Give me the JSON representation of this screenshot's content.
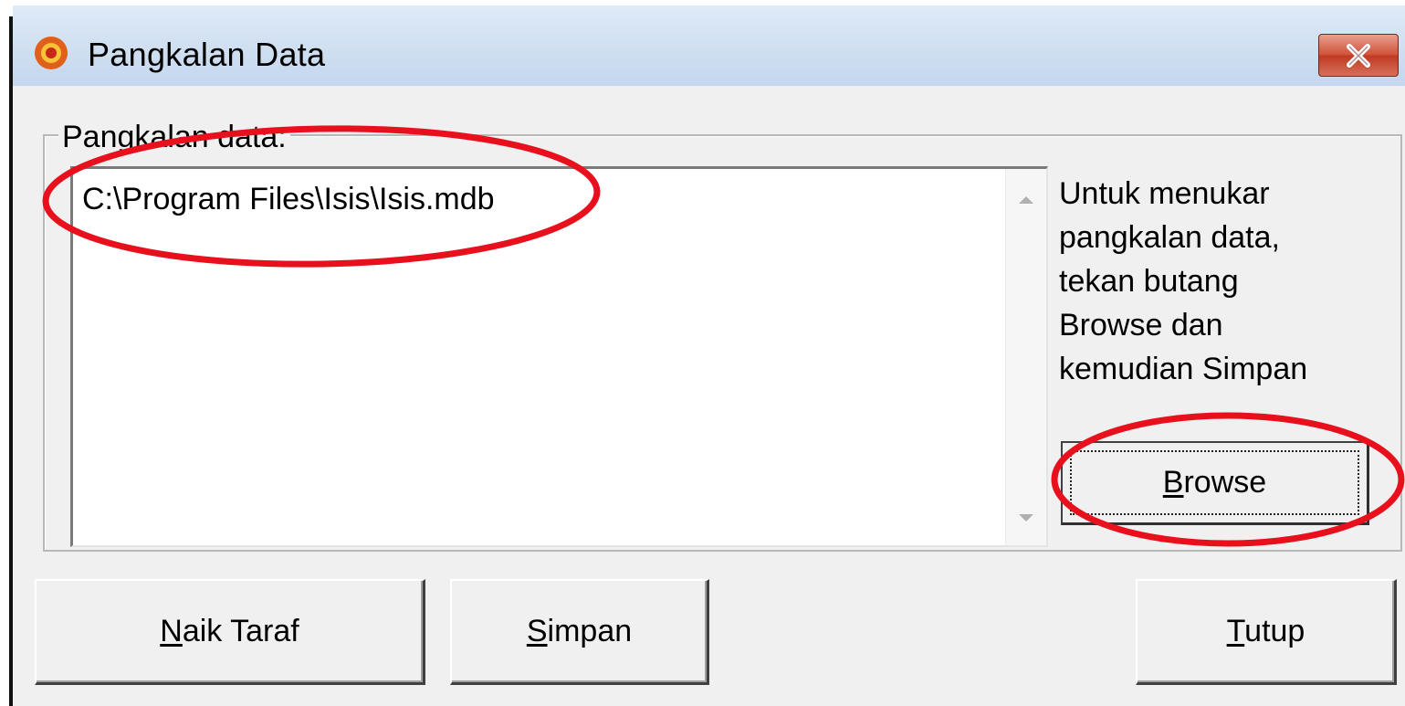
{
  "window": {
    "title": "Pangkalan Data",
    "title_bar_color": "#cfdff1",
    "close_icon": "close-icon"
  },
  "database_group": {
    "label": "Pangkalan data:",
    "items": [
      "C:\\Program Files\\Isis\\Isis.mdb"
    ]
  },
  "instructions": {
    "lines": [
      "Untuk menukar",
      "pangkalan data,",
      "tekan butang",
      "Browse dan",
      "kemudian Simpan"
    ]
  },
  "buttons": {
    "browse": {
      "mnemonic": "B",
      "rest": "rowse"
    },
    "naik_taraf": {
      "mnemonic": "N",
      "rest": "aik Taraf"
    },
    "simpan": {
      "mnemonic": "S",
      "rest": "impan"
    },
    "tutup": {
      "mnemonic": "T",
      "rest": "utup"
    }
  },
  "annotation_color": "#e8101c"
}
